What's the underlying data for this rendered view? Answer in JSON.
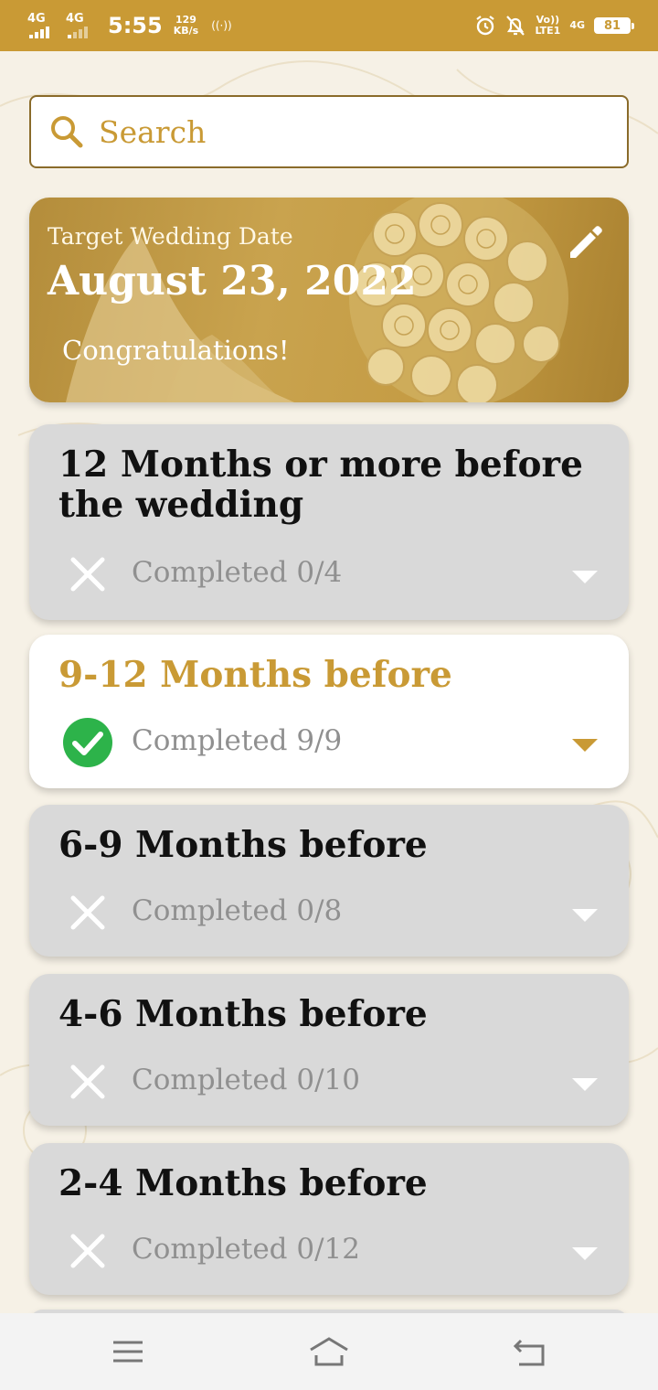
{
  "status_bar": {
    "network1": "4G",
    "network2": "4G",
    "time": "5:55",
    "speed_value": "129",
    "speed_unit": "KB/s",
    "volte_top": "Vo))",
    "volte_bottom": "LTE1",
    "network3": "4G",
    "battery": "81"
  },
  "search": {
    "placeholder": "Search"
  },
  "banner": {
    "label": "Target Wedding Date",
    "date": "August 23, 2022",
    "message": "Congratulations!"
  },
  "timeline": [
    {
      "title": "12 Months or more before the wedding",
      "progress": "Completed 0/4",
      "done": false
    },
    {
      "title": "9-12 Months before",
      "progress": "Completed 9/9",
      "done": true
    },
    {
      "title": "6-9 Months before",
      "progress": "Completed 0/8",
      "done": false
    },
    {
      "title": "4-6 Months before",
      "progress": "Completed 0/10",
      "done": false
    },
    {
      "title": "2-4 Months before",
      "progress": "Completed 0/12",
      "done": false
    }
  ],
  "colors": {
    "accent": "#c99a35",
    "card_inactive": "#d9d9d9",
    "done_green": "#2db34a"
  },
  "icons": {
    "search": "search-icon",
    "edit": "pencil-icon",
    "incomplete": "close-icon",
    "complete": "check-circle-icon",
    "expand": "caret-down-icon",
    "nav_menu": "menu-icon",
    "nav_home": "home-icon",
    "nav_back": "back-icon"
  }
}
